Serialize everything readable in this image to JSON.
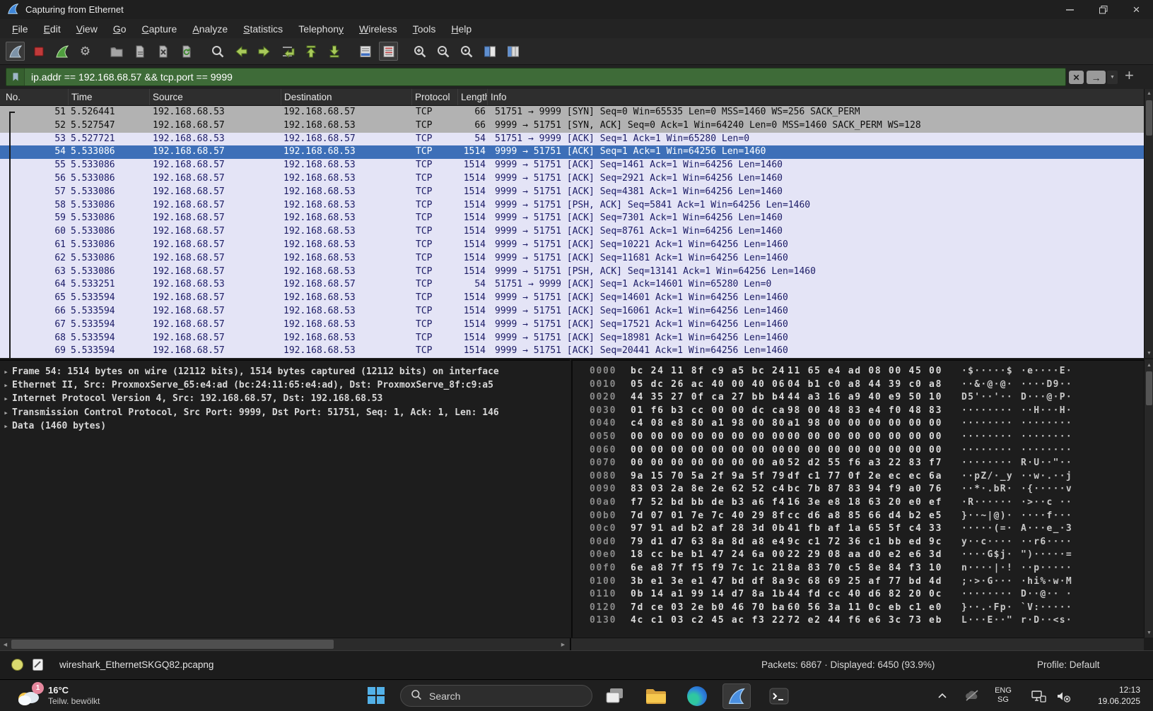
{
  "window": {
    "title": "Capturing from Ethernet"
  },
  "menu": {
    "items": [
      {
        "label": "File",
        "u": 0
      },
      {
        "label": "Edit",
        "u": 0
      },
      {
        "label": "View",
        "u": 0
      },
      {
        "label": "Go",
        "u": 0
      },
      {
        "label": "Capture",
        "u": 0
      },
      {
        "label": "Analyze",
        "u": 0
      },
      {
        "label": "Statistics",
        "u": 0
      },
      {
        "label": "Telephony",
        "u": 8
      },
      {
        "label": "Wireless",
        "u": 0
      },
      {
        "label": "Tools",
        "u": 0
      },
      {
        "label": "Help",
        "u": 0
      }
    ]
  },
  "toolbar": {
    "buttons": [
      "start-capture",
      "stop-capture",
      "restart-capture",
      "capture-options",
      "open-file",
      "save-file",
      "close-file",
      "reload-file",
      "find-packet",
      "go-back",
      "go-forward",
      "go-to-packet",
      "go-top",
      "go-bottom",
      "auto-scroll",
      "colorize-packets",
      "zoom-in",
      "zoom-out",
      "zoom-original",
      "resize-columns",
      "columns"
    ]
  },
  "filter": {
    "value": "ip.addr == 192.168.68.57 && tcp.port == 9999"
  },
  "packet_list": {
    "columns": [
      "No.",
      "Time",
      "Source",
      "Destination",
      "Protocol",
      "Length",
      "Info"
    ],
    "rows": [
      {
        "no": "51",
        "time": "5.526441",
        "src": "192.168.68.53",
        "dst": "192.168.68.57",
        "proto": "TCP",
        "len": "66",
        "info": "51751 → 9999 [SYN] Seq=0 Win=65535 Len=0 MSS=1460 WS=256 SACK_PERM",
        "state": "grey"
      },
      {
        "no": "52",
        "time": "5.527547",
        "src": "192.168.68.57",
        "dst": "192.168.68.53",
        "proto": "TCP",
        "len": "66",
        "info": "9999 → 51751 [SYN, ACK] Seq=0 Ack=1 Win=64240 Len=0 MSS=1460 SACK_PERM WS=128",
        "state": "grey"
      },
      {
        "no": "53",
        "time": "5.527721",
        "src": "192.168.68.53",
        "dst": "192.168.68.57",
        "proto": "TCP",
        "len": "54",
        "info": "51751 → 9999 [ACK] Seq=1 Ack=1 Win=65280 Len=0",
        "state": "normal"
      },
      {
        "no": "54",
        "time": "5.533086",
        "src": "192.168.68.57",
        "dst": "192.168.68.53",
        "proto": "TCP",
        "len": "1514",
        "info": "9999 → 51751 [ACK] Seq=1 Ack=1 Win=64256 Len=1460",
        "state": "selected"
      },
      {
        "no": "55",
        "time": "5.533086",
        "src": "192.168.68.57",
        "dst": "192.168.68.53",
        "proto": "TCP",
        "len": "1514",
        "info": "9999 → 51751 [ACK] Seq=1461 Ack=1 Win=64256 Len=1460",
        "state": "normal"
      },
      {
        "no": "56",
        "time": "5.533086",
        "src": "192.168.68.57",
        "dst": "192.168.68.53",
        "proto": "TCP",
        "len": "1514",
        "info": "9999 → 51751 [ACK] Seq=2921 Ack=1 Win=64256 Len=1460",
        "state": "normal"
      },
      {
        "no": "57",
        "time": "5.533086",
        "src": "192.168.68.57",
        "dst": "192.168.68.53",
        "proto": "TCP",
        "len": "1514",
        "info": "9999 → 51751 [ACK] Seq=4381 Ack=1 Win=64256 Len=1460",
        "state": "normal"
      },
      {
        "no": "58",
        "time": "5.533086",
        "src": "192.168.68.57",
        "dst": "192.168.68.53",
        "proto": "TCP",
        "len": "1514",
        "info": "9999 → 51751 [PSH, ACK] Seq=5841 Ack=1 Win=64256 Len=1460",
        "state": "normal"
      },
      {
        "no": "59",
        "time": "5.533086",
        "src": "192.168.68.57",
        "dst": "192.168.68.53",
        "proto": "TCP",
        "len": "1514",
        "info": "9999 → 51751 [ACK] Seq=7301 Ack=1 Win=64256 Len=1460",
        "state": "normal"
      },
      {
        "no": "60",
        "time": "5.533086",
        "src": "192.168.68.57",
        "dst": "192.168.68.53",
        "proto": "TCP",
        "len": "1514",
        "info": "9999 → 51751 [ACK] Seq=8761 Ack=1 Win=64256 Len=1460",
        "state": "normal"
      },
      {
        "no": "61",
        "time": "5.533086",
        "src": "192.168.68.57",
        "dst": "192.168.68.53",
        "proto": "TCP",
        "len": "1514",
        "info": "9999 → 51751 [ACK] Seq=10221 Ack=1 Win=64256 Len=1460",
        "state": "normal"
      },
      {
        "no": "62",
        "time": "5.533086",
        "src": "192.168.68.57",
        "dst": "192.168.68.53",
        "proto": "TCP",
        "len": "1514",
        "info": "9999 → 51751 [ACK] Seq=11681 Ack=1 Win=64256 Len=1460",
        "state": "normal"
      },
      {
        "no": "63",
        "time": "5.533086",
        "src": "192.168.68.57",
        "dst": "192.168.68.53",
        "proto": "TCP",
        "len": "1514",
        "info": "9999 → 51751 [PSH, ACK] Seq=13141 Ack=1 Win=64256 Len=1460",
        "state": "normal"
      },
      {
        "no": "64",
        "time": "5.533251",
        "src": "192.168.68.53",
        "dst": "192.168.68.57",
        "proto": "TCP",
        "len": "54",
        "info": "51751 → 9999 [ACK] Seq=1 Ack=14601 Win=65280 Len=0",
        "state": "normal"
      },
      {
        "no": "65",
        "time": "5.533594",
        "src": "192.168.68.57",
        "dst": "192.168.68.53",
        "proto": "TCP",
        "len": "1514",
        "info": "9999 → 51751 [ACK] Seq=14601 Ack=1 Win=64256 Len=1460",
        "state": "normal"
      },
      {
        "no": "66",
        "time": "5.533594",
        "src": "192.168.68.57",
        "dst": "192.168.68.53",
        "proto": "TCP",
        "len": "1514",
        "info": "9999 → 51751 [ACK] Seq=16061 Ack=1 Win=64256 Len=1460",
        "state": "normal"
      },
      {
        "no": "67",
        "time": "5.533594",
        "src": "192.168.68.57",
        "dst": "192.168.68.53",
        "proto": "TCP",
        "len": "1514",
        "info": "9999 → 51751 [ACK] Seq=17521 Ack=1 Win=64256 Len=1460",
        "state": "normal"
      },
      {
        "no": "68",
        "time": "5.533594",
        "src": "192.168.68.57",
        "dst": "192.168.68.53",
        "proto": "TCP",
        "len": "1514",
        "info": "9999 → 51751 [ACK] Seq=18981 Ack=1 Win=64256 Len=1460",
        "state": "normal"
      },
      {
        "no": "69",
        "time": "5.533594",
        "src": "192.168.68.57",
        "dst": "192.168.68.53",
        "proto": "TCP",
        "len": "1514",
        "info": "9999 → 51751 [ACK] Seq=20441 Ack=1 Win=64256 Len=1460",
        "state": "normal"
      }
    ]
  },
  "details": {
    "lines": [
      "Frame 54: 1514 bytes on wire (12112 bits), 1514 bytes captured (12112 bits) on interface",
      "Ethernet II, Src: ProxmoxServe_65:e4:ad (bc:24:11:65:e4:ad), Dst: ProxmoxServe_8f:c9:a5",
      "Internet Protocol Version 4, Src: 192.168.68.57, Dst: 192.168.68.53",
      "Transmission Control Protocol, Src Port: 9999, Dst Port: 51751, Seq: 1, Ack: 1, Len: 146",
      "Data (1460 bytes)"
    ]
  },
  "hex_dump": {
    "rows": [
      {
        "offset": "0000",
        "h1": "bc 24 11 8f c9 a5 bc 24",
        "h2": "11 65 e4 ad 08 00 45 00",
        "a1": "·$·····$",
        "a2": "·e····E·"
      },
      {
        "offset": "0010",
        "h1": "05 dc 26 ac 40 00 40 06",
        "h2": "04 b1 c0 a8 44 39 c0 a8",
        "a1": "··&·@·@·",
        "a2": "····D9··"
      },
      {
        "offset": "0020",
        "h1": "44 35 27 0f ca 27 bb b4",
        "h2": "44 a3 16 a9 40 e9 50 10",
        "a1": "D5'··'··",
        "a2": "D···@·P·"
      },
      {
        "offset": "0030",
        "h1": "01 f6 b3 cc 00 00 dc ca",
        "h2": "98 00 48 83 e4 f0 48 83",
        "a1": "········",
        "a2": "··H···H·"
      },
      {
        "offset": "0040",
        "h1": "c4 08 e8 80 a1 98 00 80",
        "h2": "a1 98 00 00 00 00 00 00",
        "a1": "········",
        "a2": "········"
      },
      {
        "offset": "0050",
        "h1": "00 00 00 00 00 00 00 00",
        "h2": "00 00 00 00 00 00 00 00",
        "a1": "········",
        "a2": "········"
      },
      {
        "offset": "0060",
        "h1": "00 00 00 00 00 00 00 00",
        "h2": "00 00 00 00 00 00 00 00",
        "a1": "········",
        "a2": "········"
      },
      {
        "offset": "0070",
        "h1": "00 00 00 00 00 00 00 a0",
        "h2": "52 d2 55 f6 a3 22 83 f7",
        "a1": "········",
        "a2": "R·U··\"··"
      },
      {
        "offset": "0080",
        "h1": "9a 15 70 5a 2f 9a 5f 79",
        "h2": "df c1 77 0f 2e ec ec 6a",
        "a1": "··pZ/·_y",
        "a2": "··w·.··j"
      },
      {
        "offset": "0090",
        "h1": "83 03 2a 8e 2e 62 52 c4",
        "h2": "bc 7b 87 83 94 f9 a0 76",
        "a1": "··*·.bR·",
        "a2": "·{·····v"
      },
      {
        "offset": "00a0",
        "h1": "f7 52 bd bb de b3 a6 f4",
        "h2": "16 3e e8 18 63 20 e0 ef",
        "a1": "·R······",
        "a2": "·>··c ··"
      },
      {
        "offset": "00b0",
        "h1": "7d 07 01 7e 7c 40 29 8f",
        "h2": "cc d6 a8 85 66 d4 b2 e5",
        "a1": "}··~|@)·",
        "a2": "····f···"
      },
      {
        "offset": "00c0",
        "h1": "97 91 ad b2 af 28 3d 0b",
        "h2": "41 fb af 1a 65 5f c4 33",
        "a1": "·····(=·",
        "a2": "A···e_·3"
      },
      {
        "offset": "00d0",
        "h1": "79 d1 d7 63 8a 8d a8 e4",
        "h2": "9c c1 72 36 c1 bb ed 9c",
        "a1": "y··c····",
        "a2": "··r6····"
      },
      {
        "offset": "00e0",
        "h1": "18 cc be b1 47 24 6a 00",
        "h2": "22 29 08 aa d0 e2 e6 3d",
        "a1": "····G$j·",
        "a2": "\")·····="
      },
      {
        "offset": "00f0",
        "h1": "6e a8 7f f5 f9 7c 1c 21",
        "h2": "8a 83 70 c5 8e 84 f3 10",
        "a1": "n····|·!",
        "a2": "··p·····"
      },
      {
        "offset": "0100",
        "h1": "3b e1 3e e1 47 bd df 8a",
        "h2": "9c 68 69 25 af 77 bd 4d",
        "a1": ";·>·G···",
        "a2": "·hi%·w·M"
      },
      {
        "offset": "0110",
        "h1": "0b 14 a1 99 14 d7 8a 1b",
        "h2": "44 fd cc 40 d6 82 20 0c",
        "a1": "········",
        "a2": "D··@·· ·"
      },
      {
        "offset": "0120",
        "h1": "7d ce 03 2e b0 46 70 ba",
        "h2": "60 56 3a 11 0c eb c1 e0",
        "a1": "}··.·Fp·",
        "a2": "`V:·····"
      },
      {
        "offset": "0130",
        "h1": "4c c1 03 c2 45 ac f3 22",
        "h2": "72 e2 44 f6 e6 3c 73 eb",
        "a1": "L···E··\"",
        "a2": "r·D··<s·"
      }
    ]
  },
  "status_bar": {
    "filename": "wireshark_EthernetSKGQ82.pcapng",
    "packets": "Packets: 6867 · Displayed: 6450 (93.9%)",
    "profile": "Profile: Default"
  },
  "taskbar": {
    "weather": {
      "badge": "1",
      "temp": "16°C",
      "desc": "Teilw. bewölkt"
    },
    "search": {
      "label": "Search"
    },
    "tray": {
      "lang_top": "ENG",
      "lang_bottom": "SG",
      "time": "12:13",
      "date": "19.06.2025"
    }
  }
}
